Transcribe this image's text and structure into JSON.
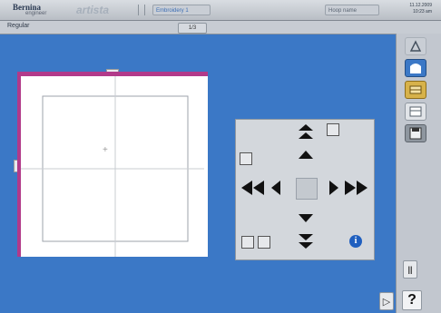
{
  "header": {
    "brand": "Bernina",
    "brand_sub": "engineer",
    "app_name": "artista",
    "field_a": "Embroidery 1",
    "field_b": "Hoop name",
    "clock_line1": "11.12.2009",
    "clock_line2": "10:23 am"
  },
  "subheader": {
    "title": "Regular",
    "control": "1/3"
  },
  "hoop": {
    "frame_color": "#b23a8a",
    "center_marker": "+"
  },
  "navpad": {
    "buttons": {
      "up_fast": "⏶⏶",
      "up": "▲",
      "down": "▼",
      "down_fast": "⏷⏷",
      "left_fast": "◀◀",
      "left": "◀",
      "right": "▶",
      "right_fast": "▶▶"
    },
    "info": "i"
  },
  "right_tools": [
    {
      "name": "stitch-tool-icon",
      "style": "plain"
    },
    {
      "name": "hoop-shape-icon",
      "style": "blue"
    },
    {
      "name": "thread-tool-icon",
      "style": "gold"
    },
    {
      "name": "pattern-tool-icon",
      "style": "light"
    },
    {
      "name": "save-tool-icon",
      "style": "grey"
    }
  ],
  "bottom_buttons": {
    "pause_label": "||",
    "play_label": "▷",
    "help_label": "?"
  },
  "colors": {
    "background": "#3b78c6",
    "accent": "#b23a8a",
    "panel": "#d3d7dc"
  }
}
